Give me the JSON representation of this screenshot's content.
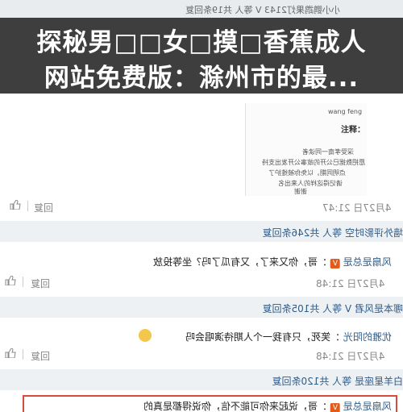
{
  "title": {
    "line1": "探秘男□□女□摸□香蕉成人",
    "line2": "网站免费版：滁州市的最..."
  },
  "top_partial": {
    "text": "小小鹦鹉果灯2143  V  等人 共19条回复"
  },
  "document": {
    "sender": "wang feng",
    "note_title": "注释：",
    "lines": [
      "深受孝南一同读者",
      "愿把数据已公开的故事公开发出支持",
      "点明同期，以免你被维护了",
      "请记得这样的人来出名",
      "谢谢"
    ]
  },
  "comments": [
    {
      "username": "",
      "text": "",
      "timestamp": "4月27日 21:47",
      "reply_label": "回复",
      "replies_summary": "墙外评影时空 等人 共246条回复"
    },
    {
      "username": "风扇是总是",
      "badge": "V",
      "text": "：哥，你又来了，又有瓜了吗？坐等投放",
      "timestamp": "4月27日 21:48",
      "reply_label": "回复",
      "replies_summary": "哪本是风君  V  等人 共105条回复"
    },
    {
      "username": "优雅的阳光",
      "text": "：笑死，只有我一个人期待演唱会吗",
      "timestamp": "4月27日 21:48",
      "reply_label": "回复",
      "replies_summary": "白羊星座是 等人 共120条回复"
    },
    {
      "username": "风扇是总是",
      "badge": "V",
      "text": "：哥，说起来你可能不信，你说得都是真的"
    }
  ],
  "colors": {
    "accent": "#2f5d8a",
    "highlight_border": "#d84b3b",
    "badge": "#e25b1a"
  }
}
